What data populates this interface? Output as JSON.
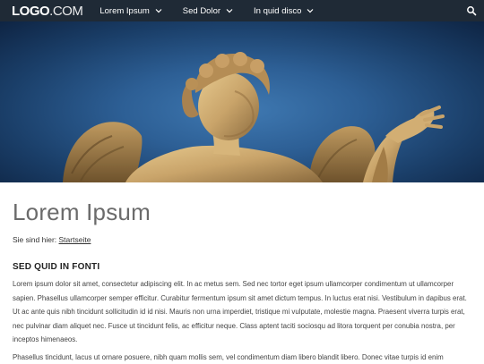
{
  "header": {
    "logo_bold": "LOGO",
    "logo_thin": ".COM",
    "nav": [
      {
        "label": "Lorem Ipsum"
      },
      {
        "label": "Sed Dolor"
      },
      {
        "label": "In quid disco"
      }
    ]
  },
  "main": {
    "title": "Lorem Ipsum",
    "breadcrumb_prefix": "Sie sind hier:",
    "breadcrumb_link": "Startseite",
    "section_heading": "SED QUID IN FONTI",
    "paragraphs": [
      "Lorem ipsum dolor sit amet, consectetur adipiscing elit. In ac metus sem. Sed nec tortor eget ipsum ullamcorper condimentum ut ullamcorper sapien. Phasellus ullamcorper semper efficitur. Curabitur fermentum ipsum sit amet dictum tempus. In luctus erat nisi. Vestibulum in dapibus erat. Ut ac ante quis nibh tincidunt sollicitudin id id nisi. Mauris non urna imperdiet, tristique mi vulputate, molestie magna. Praesent viverra turpis erat, nec pulvinar diam aliquet nec. Fusce ut tincidunt felis, ac efficitur neque. Class aptent taciti sociosqu ad litora torquent per conubia nostra, per inceptos himenaeos.",
      "Phasellus tincidunt, lacus ut ornare posuere, nibh quam mollis sem, vel condimentum diam libero blandit libero. Donec vitae turpis id enim"
    ]
  },
  "colors": {
    "nav_bg": "#1f2a36",
    "sky": "#2d5f95",
    "title": "#6b6b6b"
  },
  "icons": {
    "search": "search-icon",
    "chevron": "chevron-down-icon"
  }
}
